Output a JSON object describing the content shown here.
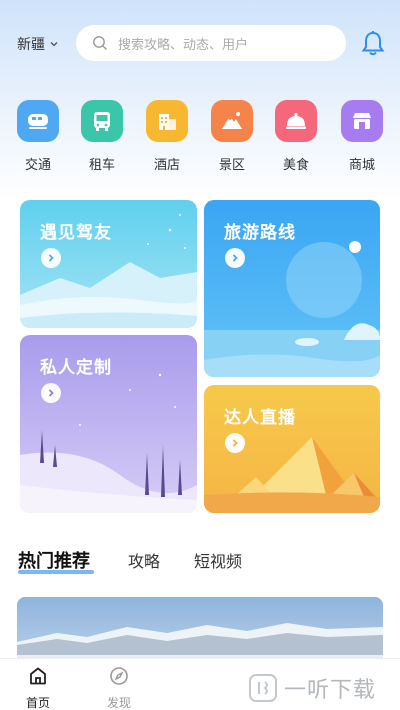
{
  "header": {
    "city": "新疆",
    "search_placeholder": "搜索攻略、动态、用户"
  },
  "categories": [
    {
      "label": "交通",
      "icon": "train-icon",
      "color": "#4ea8f2"
    },
    {
      "label": "租车",
      "icon": "bus-icon",
      "color": "#3cc6a9"
    },
    {
      "label": "酒店",
      "icon": "hotel-icon",
      "color": "#f7b731"
    },
    {
      "label": "景区",
      "icon": "mountain-icon",
      "color": "#f6834a"
    },
    {
      "label": "美食",
      "icon": "food-cloche-icon",
      "color": "#f5677a"
    },
    {
      "label": "商城",
      "icon": "shop-icon",
      "color": "#a77cf0"
    }
  ],
  "cards": {
    "meet": {
      "title": "遇见驾友"
    },
    "route": {
      "title": "旅游路线"
    },
    "custom": {
      "title": "私人定制"
    },
    "live": {
      "title": "达人直播"
    }
  },
  "tabs": [
    "热门推荐",
    "攻略",
    "短视频"
  ],
  "bottom_nav": [
    {
      "label": "首页",
      "icon": "home-icon",
      "active": true
    },
    {
      "label": "发现",
      "icon": "compass-icon",
      "active": false
    }
  ],
  "watermark": {
    "text": "一听下载"
  },
  "colors": {
    "accent": "#4f9df6",
    "nav_active": "#222222",
    "nav_inactive": "#999999"
  }
}
